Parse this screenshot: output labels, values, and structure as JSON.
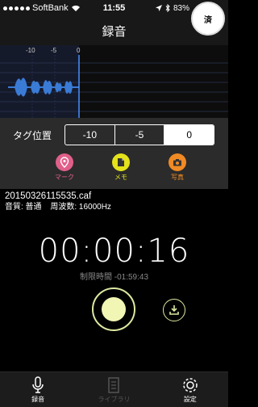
{
  "status_bar": {
    "carrier": "SoftBank",
    "time": "11:55",
    "battery": "83%"
  },
  "badge": {
    "text": "済"
  },
  "nav": {
    "title": "録音"
  },
  "waveform": {
    "ticks": [
      "-10",
      "-5",
      "0"
    ],
    "color": "#3a7bd5"
  },
  "tag": {
    "label": "タグ位置",
    "options": [
      "-10",
      "-5",
      "0"
    ],
    "selected": "0",
    "buttons": [
      {
        "label": "マーク",
        "icon": "pin-icon",
        "color": "#e0608a"
      },
      {
        "label": "メモ",
        "icon": "memo-icon",
        "color": "#e4e21a"
      },
      {
        "label": "写真",
        "icon": "camera-icon",
        "color": "#f08a24"
      }
    ]
  },
  "file": {
    "name": "20150326115535.caf",
    "quality": "音質: 普通",
    "frequency": "周波数: 16000Hz"
  },
  "timer": {
    "elapsed": "00:00:16",
    "limit": "制限時間 -01:59:43"
  },
  "tabs": [
    {
      "label": "録音",
      "icon": "microphone-icon",
      "enabled": true
    },
    {
      "label": "ライブラリ",
      "icon": "library-icon",
      "enabled": false
    },
    {
      "label": "設定",
      "icon": "gear-icon",
      "enabled": true
    }
  ]
}
